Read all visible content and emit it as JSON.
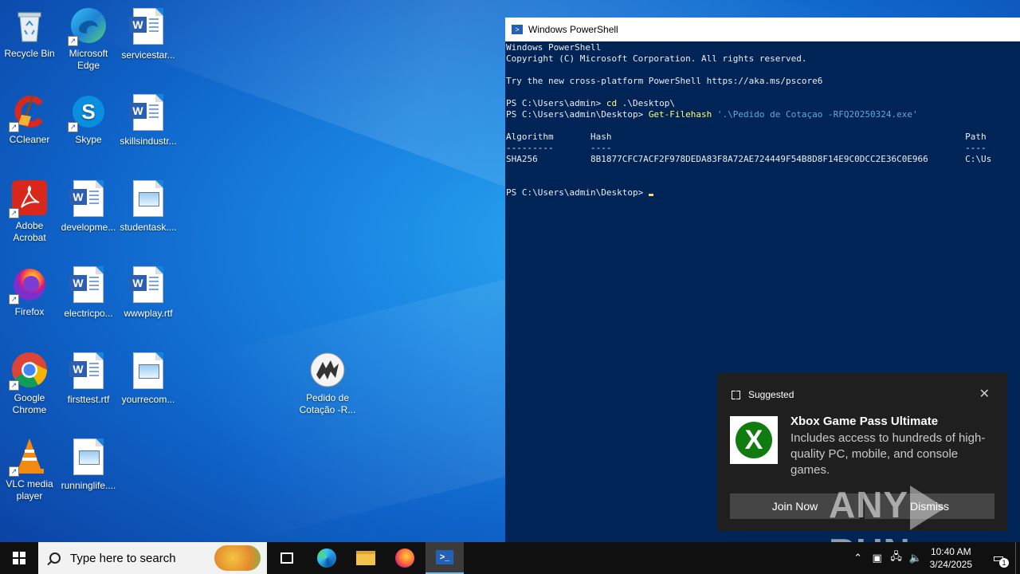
{
  "desktop": {
    "icons": [
      {
        "label": "Recycle Bin",
        "icon": "recycle-bin-icon"
      },
      {
        "label": "Microsoft Edge",
        "icon": "edge-icon"
      },
      {
        "label": "servicestar...",
        "icon": "word-doc-icon"
      },
      {
        "label": "CCleaner",
        "icon": "ccleaner-icon"
      },
      {
        "label": "Skype",
        "icon": "skype-icon"
      },
      {
        "label": "skillsindustr...",
        "icon": "word-doc-icon"
      },
      {
        "label": "Adobe Acrobat",
        "icon": "acrobat-icon"
      },
      {
        "label": "developme...",
        "icon": "word-doc-icon"
      },
      {
        "label": "studentask....",
        "icon": "image-file-icon"
      },
      {
        "label": "Firefox",
        "icon": "firefox-icon"
      },
      {
        "label": "electricpo...",
        "icon": "word-doc-icon"
      },
      {
        "label": "wwwplay.rtf",
        "icon": "word-doc-icon"
      },
      {
        "label": "Google Chrome",
        "icon": "chrome-icon"
      },
      {
        "label": "firsttest.rtf",
        "icon": "word-doc-icon"
      },
      {
        "label": "yourrecom...",
        "icon": "image-file-icon"
      },
      {
        "label": "Pedido de Cotação -R...",
        "icon": "exe-file-icon"
      },
      {
        "label": "VLC media player",
        "icon": "vlc-icon"
      },
      {
        "label": "runninglife....",
        "icon": "image-file-icon"
      }
    ]
  },
  "powershell": {
    "title": "Windows PowerShell",
    "line1": "Windows PowerShell",
    "line2": "Copyright (C) Microsoft Corporation. All rights reserved.",
    "line3": "Try the new cross-platform PowerShell https://aka.ms/pscore6",
    "prompt1": "PS C:\\Users\\admin> ",
    "cmd1": "cd",
    "arg1": " .\\Desktop\\",
    "prompt2": "PS C:\\Users\\admin\\Desktop> ",
    "cmd2": "Get-Filehash",
    "arg2": " '.\\Pedido de Cotaçao -RFQ20250324.exe'",
    "table_header": "Algorithm       Hash                                                                   Path",
    "table_rule": "---------       ----                                                                   ----",
    "table_row": "SHA256          8B1877CFC7ACF2F978DEDA83F8A72AE724449F54B8D8F14E9C0DCC2E36C0E966       C:\\Us",
    "prompt3": "PS C:\\Users\\admin\\Desktop> "
  },
  "notification": {
    "header": "Suggested",
    "title": "Xbox Game Pass Ultimate",
    "description": "Includes access to hundreds of high-quality PC, mobile, and console games.",
    "join_label": "Join Now",
    "dismiss_label": "Dismiss",
    "close_glyph": "✕",
    "xbox_glyph": "X"
  },
  "watermark": {
    "left": "ANY",
    "right": "RUN"
  },
  "taskbar": {
    "search_placeholder": "Type here to search",
    "ps_glyph": ">_",
    "time": "10:40 AM",
    "date": "3/24/2025",
    "notification_count": "1",
    "tray_icons": [
      "chevron-up-icon",
      "meet-now-icon",
      "network-icon",
      "volume-icon"
    ]
  }
}
